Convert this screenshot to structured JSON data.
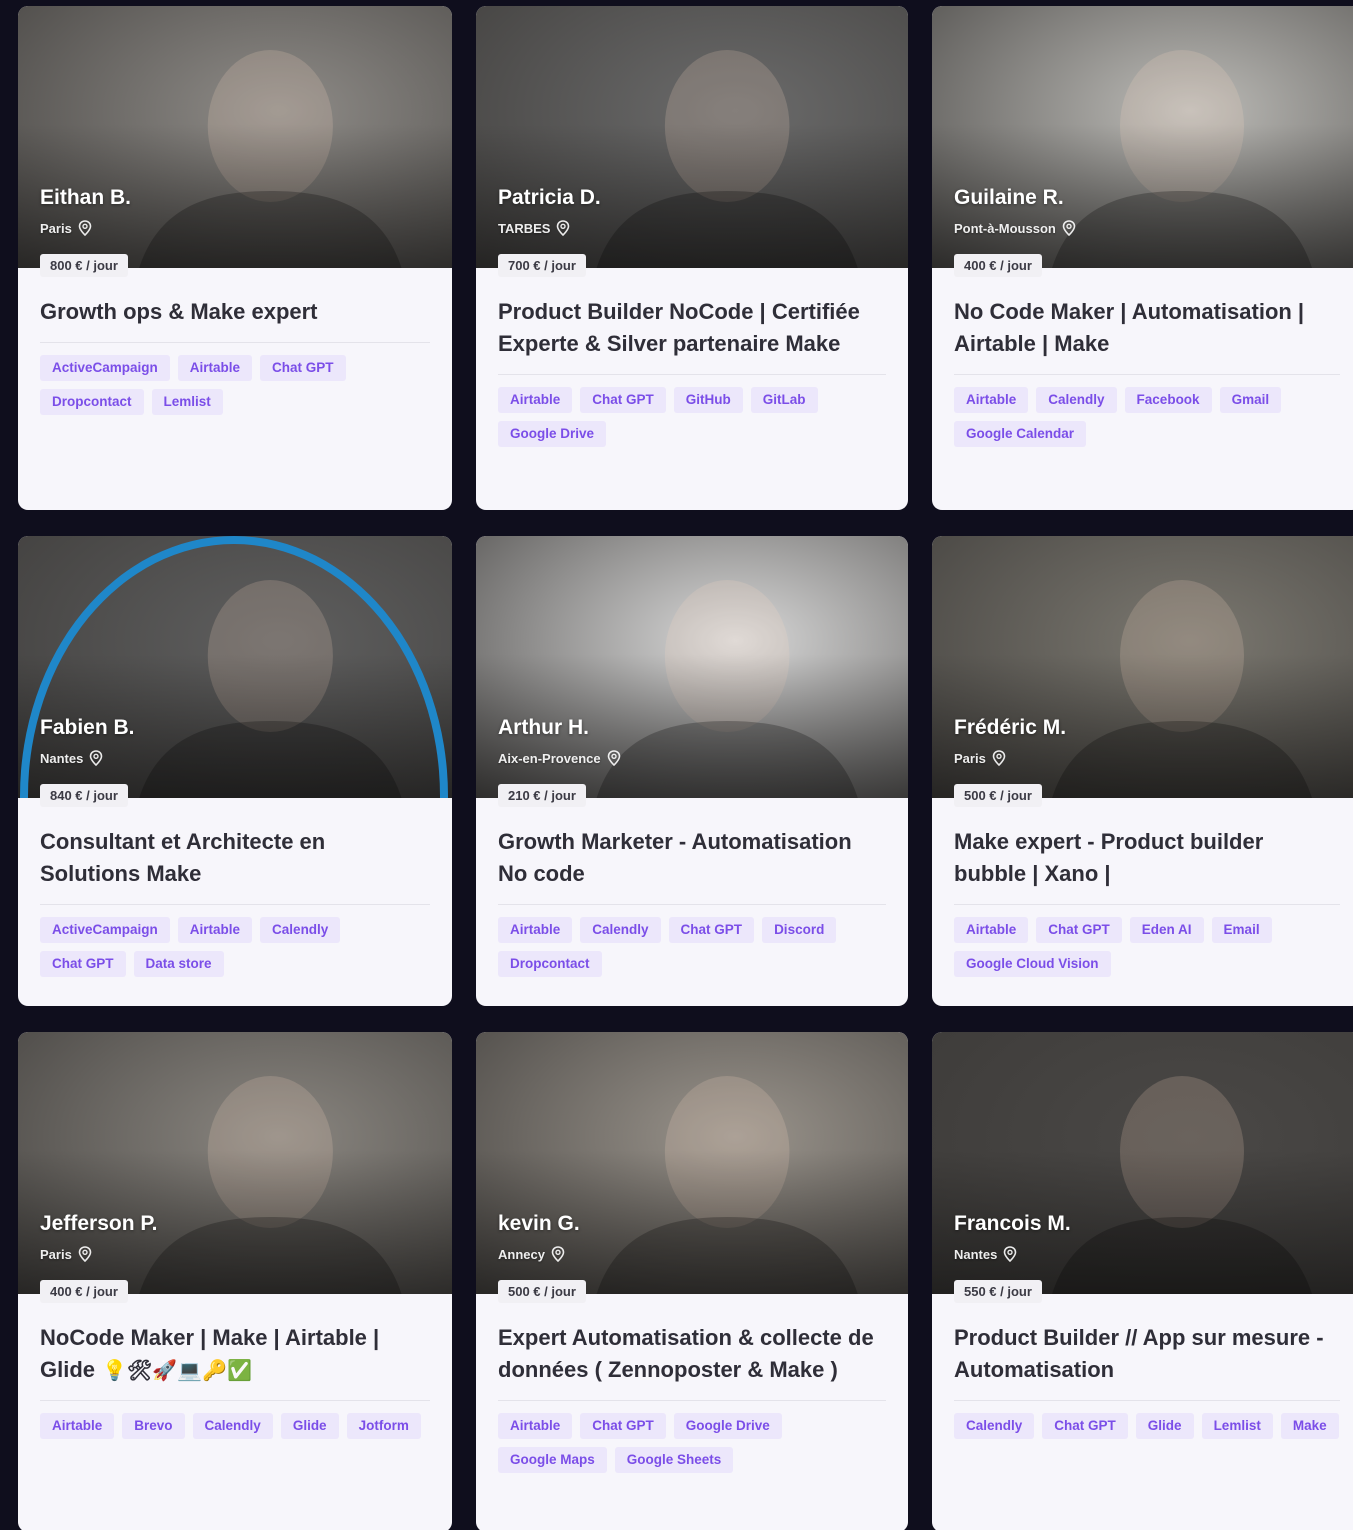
{
  "cards": [
    {
      "name": "Eithan B.",
      "city": "Paris",
      "rate": "800 € / jour",
      "title": "Growth ops & Make expert",
      "tags": [
        "ActiveCampaign",
        "Airtable",
        "Chat GPT",
        "Dropcontact",
        "Lemlist"
      ],
      "photo_color": "#8f8c88"
    },
    {
      "name": "Patricia D.",
      "city": "TARBES",
      "rate": "700 € / jour",
      "title": "Product Builder NoCode | Certifiée Experte & Silver partenaire Make",
      "tags": [
        "Airtable",
        "Chat GPT",
        "GitHub",
        "GitLab",
        "Google Drive"
      ],
      "photo_color": "#6b6b6b"
    },
    {
      "name": "Guilaine R.",
      "city": "Pont-à-Mousson",
      "rate": "400 € / jour",
      "title": "No Code Maker | Automatisation | Airtable | Make",
      "tags": [
        "Airtable",
        "Calendly",
        "Facebook",
        "Gmail",
        "Google Calendar"
      ],
      "photo_color": "#bdbcb8"
    },
    {
      "name": "Fabien B.",
      "city": "Nantes",
      "rate": "840 € / jour",
      "title": "Consultant et Architecte en Solutions Make",
      "tags": [
        "ActiveCampaign",
        "Airtable",
        "Calendly",
        "Chat GPT",
        "Data store"
      ],
      "photo_color": "#5f5f5f"
    },
    {
      "name": "Arthur H.",
      "city": "Aix-en-Provence",
      "rate": "210 € / jour",
      "title": "Growth Marketer - Automatisation No code",
      "tags": [
        "Airtable",
        "Calendly",
        "Chat GPT",
        "Discord",
        "Dropcontact"
      ],
      "photo_color": "#d9d9d9"
    },
    {
      "name": "Frédéric M.",
      "city": "Paris",
      "rate": "500 € / jour",
      "title": "Make expert - Product builder bubble | Xano |",
      "tags": [
        "Airtable",
        "Chat GPT",
        "Eden AI",
        "Email",
        "Google Cloud Vision"
      ],
      "photo_color": "#7b7870"
    },
    {
      "name": "Jefferson P.",
      "city": "Paris",
      "rate": "400 € / jour",
      "title": "NoCode Maker | Make | Airtable | Glide",
      "title_emoji": "💡🛠🚀💻🔑✅",
      "tags": [
        "Airtable",
        "Brevo",
        "Calendly",
        "Glide",
        "Jotform"
      ],
      "photo_color": "#8a8680"
    },
    {
      "name": "kevin G.",
      "city": "Annecy",
      "rate": "500 € / jour",
      "title": "Expert Automatisation & collecte de données ( Zennoposter & Make )",
      "tags": [
        "Airtable",
        "Chat GPT",
        "Google Drive",
        "Google Maps",
        "Google Sheets"
      ],
      "photo_color": "#9a948c"
    },
    {
      "name": "Francois M.",
      "city": "Nantes",
      "rate": "550 € / jour",
      "title": "Product Builder // App sur mesure - Automatisation",
      "tags": [
        "Calendly",
        "Chat GPT",
        "Glide",
        "Lemlist",
        "Make"
      ],
      "photo_color": "#4a4846"
    }
  ]
}
